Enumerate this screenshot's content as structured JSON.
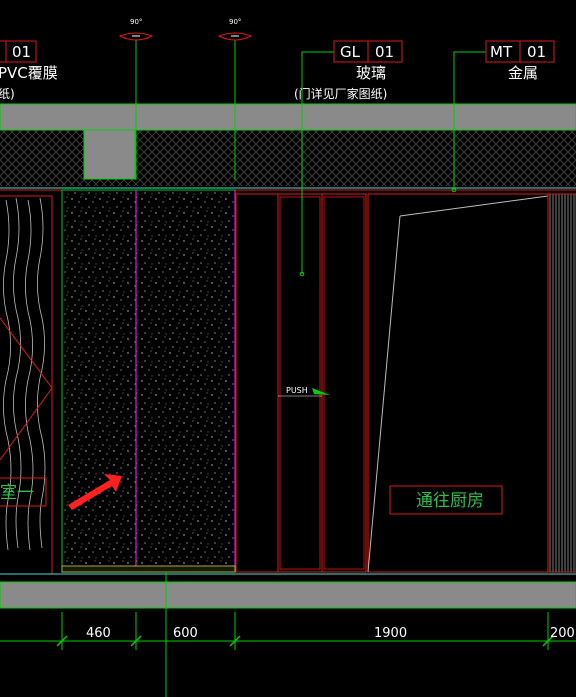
{
  "drawing": {
    "background": "#000000",
    "colors": {
      "green": "#00d000",
      "red": "#e01818",
      "magenta": "#d020d0",
      "cyan": "#40e0e0",
      "gray": "#8a8a8a",
      "white": "#ffffff",
      "hatch": "#3a3a3a",
      "accent_red": "#ff2020",
      "green_text": "#2fbf4f"
    },
    "door_swing_markers": [
      {
        "angle_label": "90°"
      },
      {
        "angle_label": "90°"
      }
    ],
    "material_tags": [
      {
        "code": "",
        "number": "01",
        "name": "PVC覆膜",
        "note": "纸)"
      },
      {
        "code": "GL",
        "number": "01",
        "name": "玻璃",
        "note": "(门详见厂家图纸)"
      },
      {
        "code": "MT",
        "number": "01",
        "name": "金属",
        "note": ""
      }
    ],
    "room_labels": [
      {
        "text": "室一"
      },
      {
        "text": "通往厨房"
      }
    ],
    "push_label": "PUSH",
    "dimensions": [
      "460",
      "600",
      "1900",
      "200"
    ],
    "icons": [
      "arrow-icon",
      "door-swing-icon"
    ]
  }
}
